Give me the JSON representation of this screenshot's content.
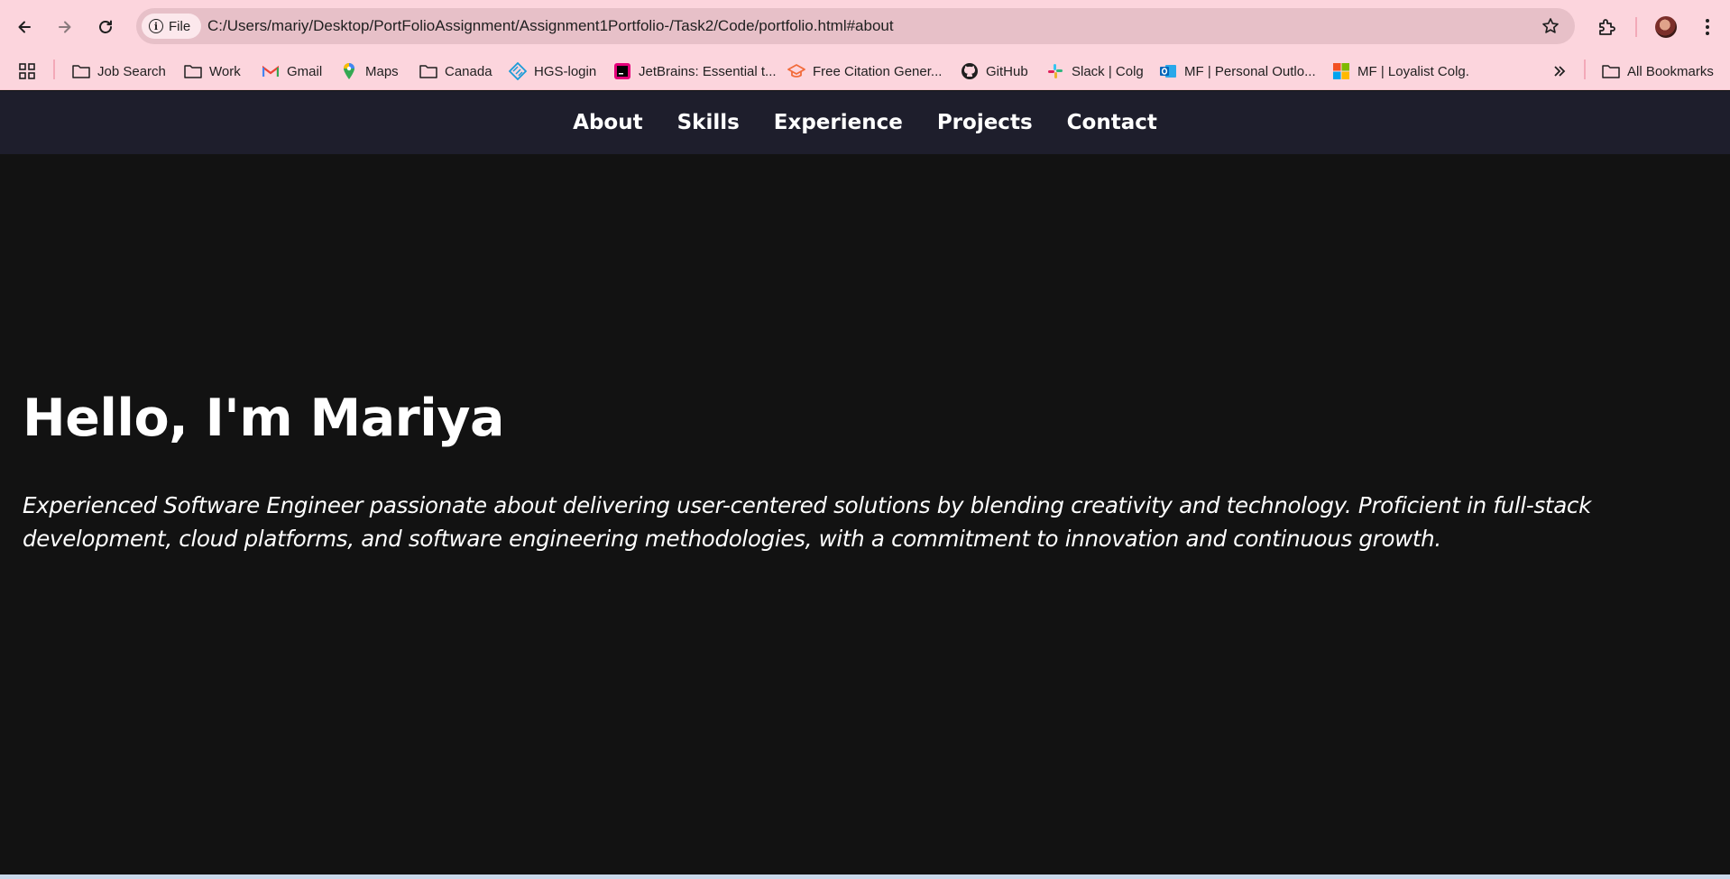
{
  "browser": {
    "file_chip": "File",
    "url": "C:/Users/mariy/Desktop/PortFolioAssignment/Assignment1Portfolio-/Task2/Code/portfolio.html#about",
    "accent": "#fcd5dd"
  },
  "bookmarks": [
    {
      "label": "Job Search",
      "icon": "folder-icon"
    },
    {
      "label": "Work",
      "icon": "folder-icon"
    },
    {
      "label": "Gmail",
      "icon": "gmail-icon"
    },
    {
      "label": "Maps",
      "icon": "maps-icon"
    },
    {
      "label": "Canada",
      "icon": "folder-icon"
    },
    {
      "label": "HGS-login",
      "icon": "hgs-icon"
    },
    {
      "label": "JetBrains: Essential t...",
      "icon": "jetbrains-icon"
    },
    {
      "label": "Free Citation Gener...",
      "icon": "citation-icon"
    },
    {
      "label": "GitHub",
      "icon": "github-icon"
    },
    {
      "label": "Slack | Colg",
      "icon": "slack-icon"
    },
    {
      "label": "MF | Personal Outlo...",
      "icon": "outlook-icon"
    },
    {
      "label": "MF | Loyalist Colg.",
      "icon": "microsoft-icon"
    }
  ],
  "all_bookmarks": "All Bookmarks",
  "site": {
    "nav": [
      "About",
      "Skills",
      "Experience",
      "Projects",
      "Contact"
    ],
    "nav_bg": "#1e1e2c",
    "page_bg": "#121212",
    "hero_title": "Hello, I'm Mariya",
    "hero_line1": "Experienced Software Engineer passionate about delivering user-centered solutions by blending creativity and technology. Proficient in full-stack",
    "hero_line2": "development, cloud platforms, and software engineering methodologies, with a commitment to innovation and continuous growth."
  }
}
